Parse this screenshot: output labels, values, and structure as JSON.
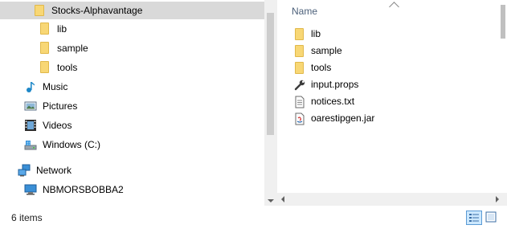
{
  "nav": {
    "items": [
      {
        "label": "Stocks-Alphavantage",
        "icon": "folder-icon",
        "selected": true
      },
      {
        "label": "lib",
        "icon": "folder-icon"
      },
      {
        "label": "sample",
        "icon": "folder-icon"
      },
      {
        "label": "tools",
        "icon": "folder-icon"
      },
      {
        "label": "Music",
        "icon": "music-note-icon"
      },
      {
        "label": "Pictures",
        "icon": "pictures-icon"
      },
      {
        "label": "Videos",
        "icon": "videos-icon"
      },
      {
        "label": "Windows (C:)",
        "icon": "drive-icon"
      },
      {
        "label": "Network",
        "icon": "network-icon"
      },
      {
        "label": "NBMORSBOBBA2",
        "icon": "computer-icon"
      }
    ]
  },
  "content": {
    "column_header": "Name",
    "files": [
      {
        "name": "lib",
        "icon": "folder-icon"
      },
      {
        "name": "sample",
        "icon": "folder-icon"
      },
      {
        "name": "tools",
        "icon": "folder-icon"
      },
      {
        "name": "input.props",
        "icon": "wrench-file-icon"
      },
      {
        "name": "notices.txt",
        "icon": "text-file-icon"
      },
      {
        "name": "oarestipgen.jar",
        "icon": "jar-file-icon"
      }
    ]
  },
  "status": {
    "item_count": "6 items"
  },
  "colors": {
    "folder": "#f8d775",
    "selected_bg": "#d9d9d9",
    "header_text": "#4c607a",
    "accent": "#5b9bd5"
  }
}
